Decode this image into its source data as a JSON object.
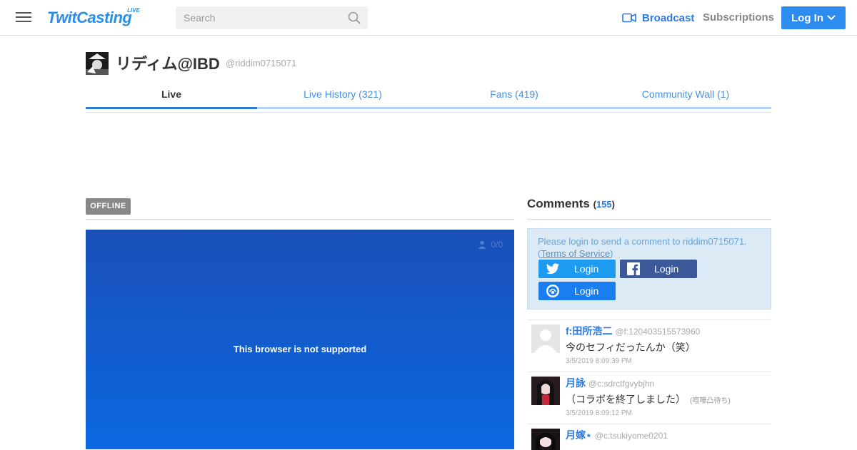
{
  "header": {
    "logo": "TwitCasting",
    "logo_badge": "LIVE",
    "search_placeholder": "Search",
    "broadcast": "Broadcast",
    "subscriptions": "Subscriptions",
    "login": "Log In",
    "accent": "#2d8cf0"
  },
  "profile": {
    "name": "リディム@IBD",
    "handle": "@riddim0715071"
  },
  "tabs": [
    {
      "label": "Live",
      "active": true
    },
    {
      "label": "Live History (321)"
    },
    {
      "label": "Fans (419)"
    },
    {
      "label": "Community Wall (1)"
    }
  ],
  "live": {
    "status": "OFFLINE",
    "viewers": "0/0",
    "message": "This browser is not supported"
  },
  "comments": {
    "title": "Comments",
    "count": "155",
    "login_message": "Please login to send a comment to riddim0715071.",
    "tos_label": "Terms of Service",
    "buttons": {
      "twitter": "Login",
      "facebook": "Login",
      "twitcasting": "Login"
    },
    "items": [
      {
        "name": "f:田所浩二",
        "id": "@f:120403515573960",
        "text": "今のセフィだったんか（笑）",
        "tag": "",
        "time": "3/5/2019 8:09:39 PM"
      },
      {
        "name": "月詠",
        "id": "@c:sdrctfgvybjhn",
        "text": "（コラボを終了しました）",
        "tag": "(喧嘩凸待ち)",
        "time": "3/5/2019 8:09:12 PM"
      },
      {
        "name": "月嫁⋆",
        "id": "@c:tsukiyome0201",
        "text": "",
        "tag": "",
        "time": ""
      }
    ]
  }
}
